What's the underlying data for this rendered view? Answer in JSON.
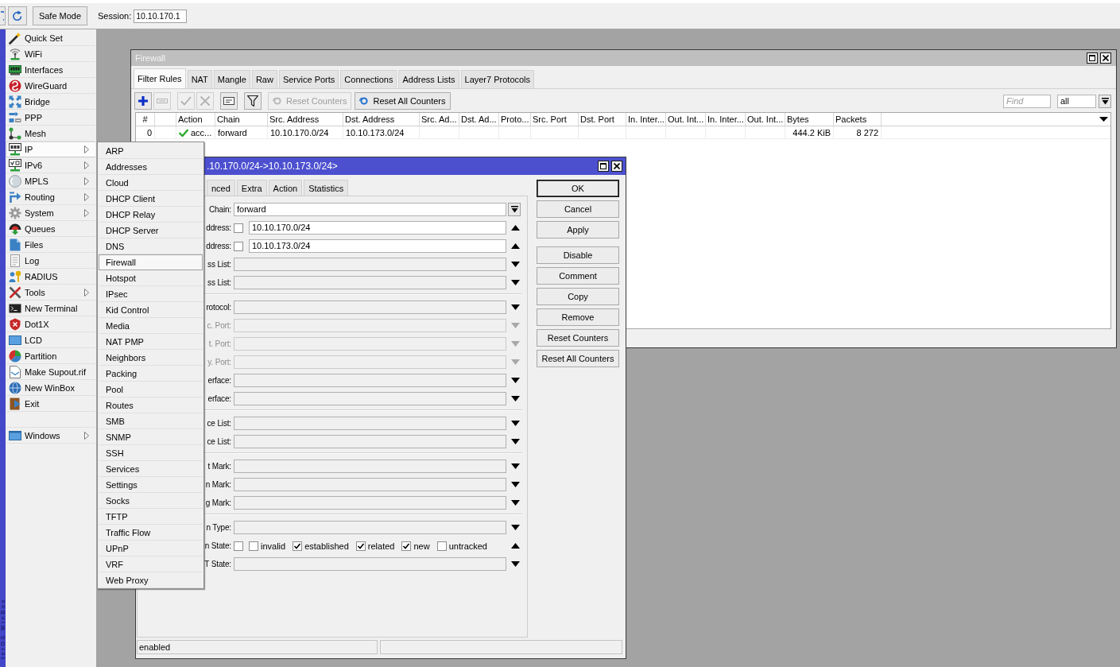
{
  "toolbar": {
    "safe_mode": {
      "label": "Safe Mode",
      "on": false
    },
    "session": {
      "label": "Session:",
      "value": "10.10.170.1"
    }
  },
  "brand": "terOS WinBox",
  "sidebar": {
    "items": [
      {
        "label": "Quick Set",
        "kind": "quickset",
        "submenu": false,
        "selected": false
      },
      {
        "label": "WiFi",
        "kind": "wifi",
        "submenu": false,
        "selected": false
      },
      {
        "label": "Interfaces",
        "kind": "interfaces",
        "submenu": false,
        "selected": false
      },
      {
        "label": "WireGuard",
        "kind": "wireguard",
        "submenu": false,
        "selected": false
      },
      {
        "label": "Bridge",
        "kind": "bridge",
        "submenu": false,
        "selected": false
      },
      {
        "label": "PPP",
        "kind": "ppp",
        "submenu": false,
        "selected": false
      },
      {
        "label": "Mesh",
        "kind": "mesh",
        "submenu": false,
        "selected": false
      },
      {
        "label": "IP",
        "kind": "ip",
        "submenu": true,
        "selected": true
      },
      {
        "label": "IPv6",
        "kind": "ipv6",
        "submenu": true,
        "selected": false
      },
      {
        "label": "MPLS",
        "kind": "mpls",
        "submenu": true,
        "selected": false
      },
      {
        "label": "Routing",
        "kind": "routing",
        "submenu": true,
        "selected": false
      },
      {
        "label": "System",
        "kind": "system",
        "submenu": true,
        "selected": false
      },
      {
        "label": "Queues",
        "kind": "queues",
        "submenu": false,
        "selected": false
      },
      {
        "label": "Files",
        "kind": "files",
        "submenu": false,
        "selected": false
      },
      {
        "label": "Log",
        "kind": "log",
        "submenu": false,
        "selected": false
      },
      {
        "label": "RADIUS",
        "kind": "radius",
        "submenu": false,
        "selected": false
      },
      {
        "label": "Tools",
        "kind": "tools",
        "submenu": true,
        "selected": false
      },
      {
        "label": "New Terminal",
        "kind": "terminal",
        "submenu": false,
        "selected": false
      },
      {
        "label": "Dot1X",
        "kind": "dot1x",
        "submenu": false,
        "selected": false
      },
      {
        "label": "LCD",
        "kind": "lcd",
        "submenu": false,
        "selected": false
      },
      {
        "label": "Partition",
        "kind": "partition",
        "submenu": false,
        "selected": false
      },
      {
        "label": "Make Supout.rif",
        "kind": "supout",
        "submenu": false,
        "selected": false
      },
      {
        "label": "New WinBox",
        "kind": "winbox",
        "submenu": false,
        "selected": false
      },
      {
        "label": "Exit",
        "kind": "exit",
        "submenu": false,
        "selected": false
      }
    ],
    "footer_items": [
      {
        "label": "Windows",
        "kind": "windows",
        "submenu": true,
        "selected": false
      }
    ]
  },
  "submenu": {
    "items": [
      {
        "label": "ARP",
        "selected": false
      },
      {
        "label": "Addresses",
        "selected": false
      },
      {
        "label": "Cloud",
        "selected": false
      },
      {
        "label": "DHCP Client",
        "selected": false
      },
      {
        "label": "DHCP Relay",
        "selected": false
      },
      {
        "label": "DHCP Server",
        "selected": false
      },
      {
        "label": "DNS",
        "selected": false
      },
      {
        "label": "Firewall",
        "selected": true
      },
      {
        "label": "Hotspot",
        "selected": false
      },
      {
        "label": "IPsec",
        "selected": false
      },
      {
        "label": "Kid Control",
        "selected": false
      },
      {
        "label": "Media",
        "selected": false
      },
      {
        "label": "NAT PMP",
        "selected": false
      },
      {
        "label": "Neighbors",
        "selected": false
      },
      {
        "label": "Packing",
        "selected": false
      },
      {
        "label": "Pool",
        "selected": false
      },
      {
        "label": "Routes",
        "selected": false
      },
      {
        "label": "SMB",
        "selected": false
      },
      {
        "label": "SNMP",
        "selected": false
      },
      {
        "label": "SSH",
        "selected": false
      },
      {
        "label": "Services",
        "selected": false
      },
      {
        "label": "Settings",
        "selected": false
      },
      {
        "label": "Socks",
        "selected": false
      },
      {
        "label": "TFTP",
        "selected": false
      },
      {
        "label": "Traffic Flow",
        "selected": false
      },
      {
        "label": "UPnP",
        "selected": false
      },
      {
        "label": "VRF",
        "selected": false
      },
      {
        "label": "Web Proxy",
        "selected": false
      }
    ]
  },
  "firewall": {
    "title": "Firewall",
    "active": false,
    "tabs": [
      {
        "label": "Filter Rules",
        "selected": true
      },
      {
        "label": "NAT",
        "selected": false
      },
      {
        "label": "Mangle",
        "selected": false
      },
      {
        "label": "Raw",
        "selected": false
      },
      {
        "label": "Service Ports",
        "selected": false
      },
      {
        "label": "Connections",
        "selected": false
      },
      {
        "label": "Address Lists",
        "selected": false
      },
      {
        "label": "Layer7 Protocols",
        "selected": false
      }
    ],
    "toolbar": {
      "icon_groups": [
        [
          {
            "kind": "add",
            "disabled": false
          },
          {
            "kind": "remove",
            "disabled": true
          }
        ],
        [
          {
            "kind": "enable",
            "disabled": true
          },
          {
            "kind": "disable",
            "disabled": true
          }
        ],
        [
          {
            "kind": "comment",
            "disabled": false
          }
        ],
        [
          {
            "kind": "filter",
            "disabled": false
          }
        ]
      ],
      "buttons": [
        {
          "label": "Reset Counters",
          "disabled": true
        },
        {
          "label": "Reset All Counters",
          "disabled": false
        }
      ],
      "find": {
        "placeholder": "Find"
      },
      "filter_select": {
        "value": "all"
      }
    },
    "table": {
      "columns": [
        "#",
        "Action",
        "Chain",
        "Src. Address",
        "Dst. Address",
        "Src. Ad...",
        "Dst. Ad...",
        "Proto...",
        "Src. Port",
        "Dst. Port",
        "In. Inter...",
        "Out. Int...",
        "In. Inter...",
        "Out. Int...",
        "Bytes",
        "Packets"
      ],
      "rows": [
        {
          "kind": "accept",
          "selected": false,
          "number": "0",
          "action": "acc...",
          "chain": "forward",
          "src_address": "10.10.170.0/24",
          "dst_address": "10.10.173.0/24",
          "bytes": "444.2 KiB",
          "packets": "8 272"
        }
      ]
    }
  },
  "rule_dialog": {
    "title": ".10.170.0/24->10.10.173.0/24>",
    "active": true,
    "tabs": [
      {
        "label": "nced",
        "selected": false
      },
      {
        "label": "Extra",
        "selected": false
      },
      {
        "label": "Action",
        "selected": false
      },
      {
        "label": "Statistics",
        "selected": false
      }
    ],
    "field_groups": [
      [
        {
          "label": "Chain:",
          "kind": "select",
          "value": "forward"
        },
        {
          "label": "ddress:",
          "kind": "address",
          "value": "10.10.170.0/24",
          "negated": false,
          "expanded": true
        },
        {
          "label": "ddress:",
          "kind": "address",
          "value": "10.10.173.0/24",
          "negated": false,
          "expanded": true
        },
        {
          "label": "ss List:",
          "kind": "combo",
          "expanded": false,
          "disabled": false
        },
        {
          "label": "ss List:",
          "kind": "combo",
          "expanded": false,
          "disabled": false
        }
      ],
      [
        {
          "label": "rotocol:",
          "kind": "combo",
          "expanded": false,
          "disabled": false
        },
        {
          "label": "c. Port:",
          "kind": "combo",
          "expanded": false,
          "disabled": true
        },
        {
          "label": "t. Port:",
          "kind": "combo",
          "expanded": false,
          "disabled": true
        },
        {
          "label": "y. Port:",
          "kind": "combo",
          "expanded": false,
          "disabled": true
        },
        {
          "label": "erface:",
          "kind": "combo",
          "expanded": false,
          "disabled": false
        },
        {
          "label": "erface:",
          "kind": "combo",
          "expanded": false,
          "disabled": false
        }
      ],
      [
        {
          "label": "ce List:",
          "kind": "combo",
          "expanded": false,
          "disabled": false
        },
        {
          "label": "ce List:",
          "kind": "combo",
          "expanded": false,
          "disabled": false
        }
      ],
      [
        {
          "label": "t Mark:",
          "kind": "combo",
          "expanded": false,
          "disabled": false
        },
        {
          "label": "n Mark:",
          "kind": "combo",
          "expanded": false,
          "disabled": false
        },
        {
          "label": "g Mark:",
          "kind": "combo",
          "expanded": false,
          "disabled": false
        }
      ],
      [
        {
          "label": "n Type:",
          "kind": "combo",
          "expanded": false,
          "disabled": false
        },
        {
          "label": "n State:",
          "kind": "states",
          "negated": false,
          "expanded": true,
          "options": [
            {
              "label": "invalid",
              "checked": false
            },
            {
              "label": "established",
              "checked": true
            },
            {
              "label": "related",
              "checked": true
            },
            {
              "label": "new",
              "checked": true
            },
            {
              "label": "untracked",
              "checked": false
            }
          ]
        },
        {
          "label": "T State:",
          "kind": "combo",
          "expanded": false,
          "disabled": false
        }
      ]
    ],
    "buttons": [
      [
        {
          "label": "OK",
          "default": true
        },
        {
          "label": "Cancel",
          "default": false
        },
        {
          "label": "Apply",
          "default": false
        }
      ],
      [
        {
          "label": "Disable",
          "default": false
        },
        {
          "label": "Comment",
          "default": false
        },
        {
          "label": "Copy",
          "default": false
        },
        {
          "label": "Remove",
          "default": false
        },
        {
          "label": "Reset Counters",
          "default": false
        },
        {
          "label": "Reset All Counters",
          "default": false
        }
      ]
    ],
    "status_bar": {
      "text": "enabled"
    }
  }
}
